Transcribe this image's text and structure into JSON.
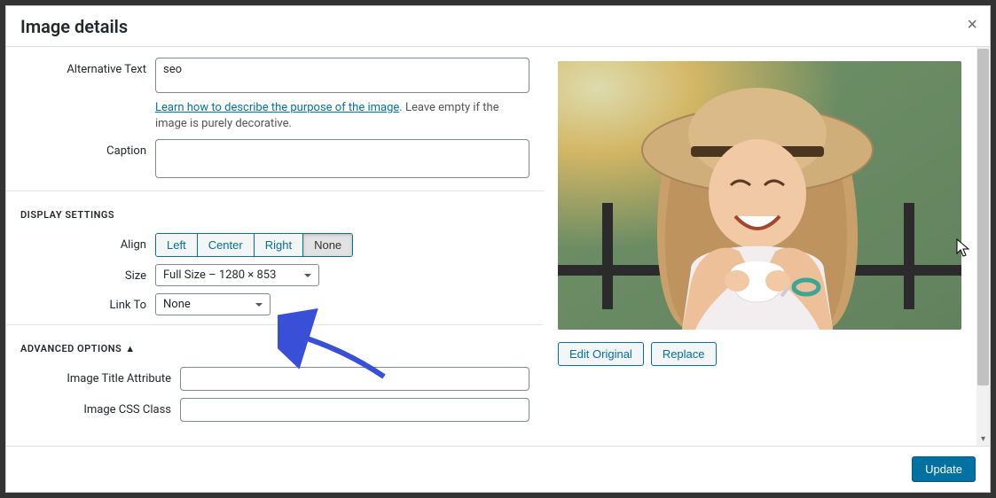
{
  "modal": {
    "title": "Image details",
    "close_icon": "×"
  },
  "fields": {
    "alt_label": "Alternative Text",
    "alt_value": "seo",
    "alt_help_link": "Learn how to describe the purpose of the image",
    "alt_help_text": ". Leave empty if the image is purely decorative.",
    "caption_label": "Caption",
    "caption_value": ""
  },
  "display": {
    "section": "DISPLAY SETTINGS",
    "align_label": "Align",
    "align_options": {
      "left": "Left",
      "center": "Center",
      "right": "Right",
      "none": "None"
    },
    "align_selected": "none",
    "size_label": "Size",
    "size_value": "Full Size – 1280 × 853",
    "link_label": "Link To",
    "link_value": "None"
  },
  "advanced": {
    "section": "ADVANCED OPTIONS",
    "title_attr_label": "Image Title Attribute",
    "title_attr_value": "",
    "css_class_label": "Image CSS Class",
    "css_class_value": ""
  },
  "preview": {
    "edit_original": "Edit Original",
    "replace": "Replace"
  },
  "footer": {
    "update": "Update"
  }
}
